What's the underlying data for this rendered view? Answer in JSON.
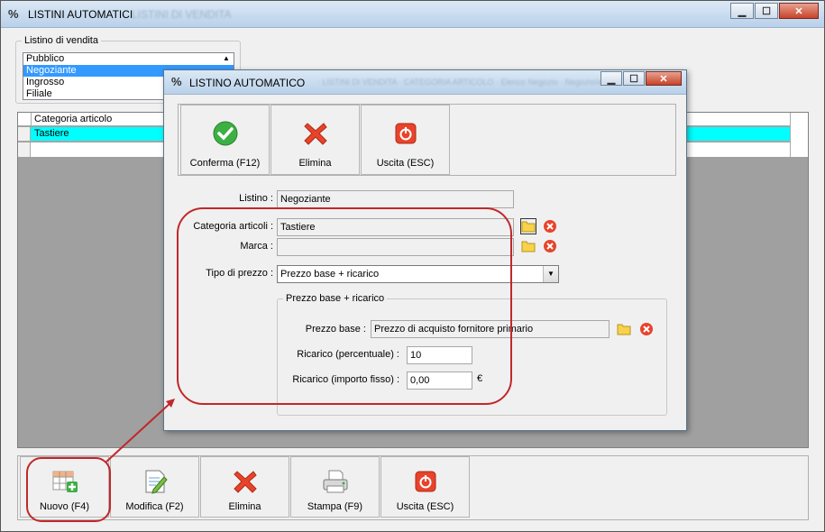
{
  "main_window": {
    "title": "LISTINI AUTOMATICI",
    "ghost_title": "LISTINI DI VENDITA",
    "listino_group": {
      "label": "Listino di vendita",
      "items": [
        "Pubblico",
        "Negoziante",
        "Ingrosso",
        "Filiale"
      ],
      "selected": "Negoziante"
    },
    "grid": {
      "column_header": "Categoria articolo",
      "rows": [
        "Tastiere"
      ]
    },
    "toolbar": [
      {
        "label": "Nuovo (F4)",
        "icon": "add-grid-icon"
      },
      {
        "label": "Modifica (F2)",
        "icon": "edit-document-icon"
      },
      {
        "label": "Elimina",
        "icon": "delete-x-icon"
      },
      {
        "label": "Stampa (F9)",
        "icon": "printer-icon"
      },
      {
        "label": "Uscita (ESC)",
        "icon": "power-exit-icon"
      }
    ]
  },
  "dialog": {
    "title": "LISTINO AUTOMATICO",
    "ghost_title": "· LISTINI DI VENDITA · CATEGORIA ARTICOLO · Elenco Negozio · Negozio/a",
    "toolbar": [
      {
        "label": "Conferma (F12)",
        "icon": "confirm-check-icon"
      },
      {
        "label": "Elimina",
        "icon": "delete-x-icon"
      },
      {
        "label": "Uscita (ESC)",
        "icon": "power-exit-icon"
      }
    ],
    "form": {
      "listino_label": "Listino :",
      "listino_value": "Negoziante",
      "categoria_label": "Categoria articoli :",
      "categoria_value": "Tastiere",
      "marca_label": "Marca :",
      "marca_value": "",
      "tipo_label": "Tipo di prezzo :",
      "tipo_value": "Prezzo base + ricarico",
      "price_group_label": "Prezzo base + ricarico",
      "prezzo_base_label": "Prezzo base :",
      "prezzo_base_value": "Prezzo di acquisto fornitore primario",
      "ricarico_perc_label": "Ricarico (percentuale) :",
      "ricarico_perc_value": "10",
      "ricarico_fisso_label": "Ricarico (importo fisso) :",
      "ricarico_fisso_value": "0,00",
      "currency": "€"
    }
  },
  "colors": {
    "grid_selected_row": "#00ffff",
    "list_selected": "#3399ff",
    "annotation": "#c0282a"
  }
}
